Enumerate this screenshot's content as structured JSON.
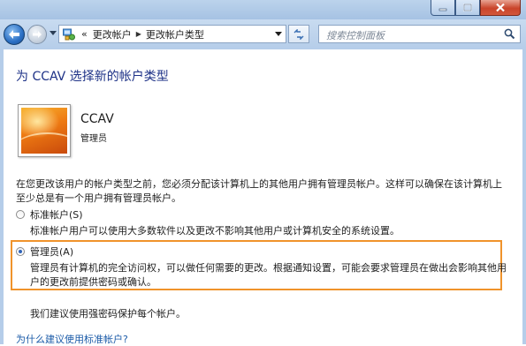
{
  "navigation": {
    "breadcrumb": {
      "prefix": "«",
      "items": [
        "更改帐户",
        "更改帐户类型"
      ]
    },
    "search": {
      "placeholder": "搜索控制面板"
    }
  },
  "main": {
    "heading": "为 CCAV 选择新的帐户类型",
    "account": {
      "name": "CCAV",
      "type": "管理员"
    },
    "intro_text": "在您更改该用户的帐户类型之前，您必须分配该计算机上的其他用户拥有管理员帐户。这样可以确保在该计算机上至少总是有一个用户拥有管理员帐户。",
    "options": [
      {
        "label": "标准帐户(S)",
        "description": "标准帐户用户可以使用大多数软件以及更改不影响其他用户或计算机安全的系统设置。",
        "selected": false
      },
      {
        "label": "管理员(A)",
        "description": "管理员有计算机的完全访问权，可以做任何需要的更改。根据通知设置，可能会要求管理员在做出会影响其他用户的更改前提供密码或确认。",
        "selected": true
      }
    ],
    "recommendation": "我们建议使用强密码保护每个帐户。",
    "help_link": "为什么建议使用标准帐户?"
  },
  "colors": {
    "heading": "#1e3287",
    "link": "#1b5ba8",
    "highlight_border": "#f0932b",
    "titlebar": "#bcd3ec"
  }
}
